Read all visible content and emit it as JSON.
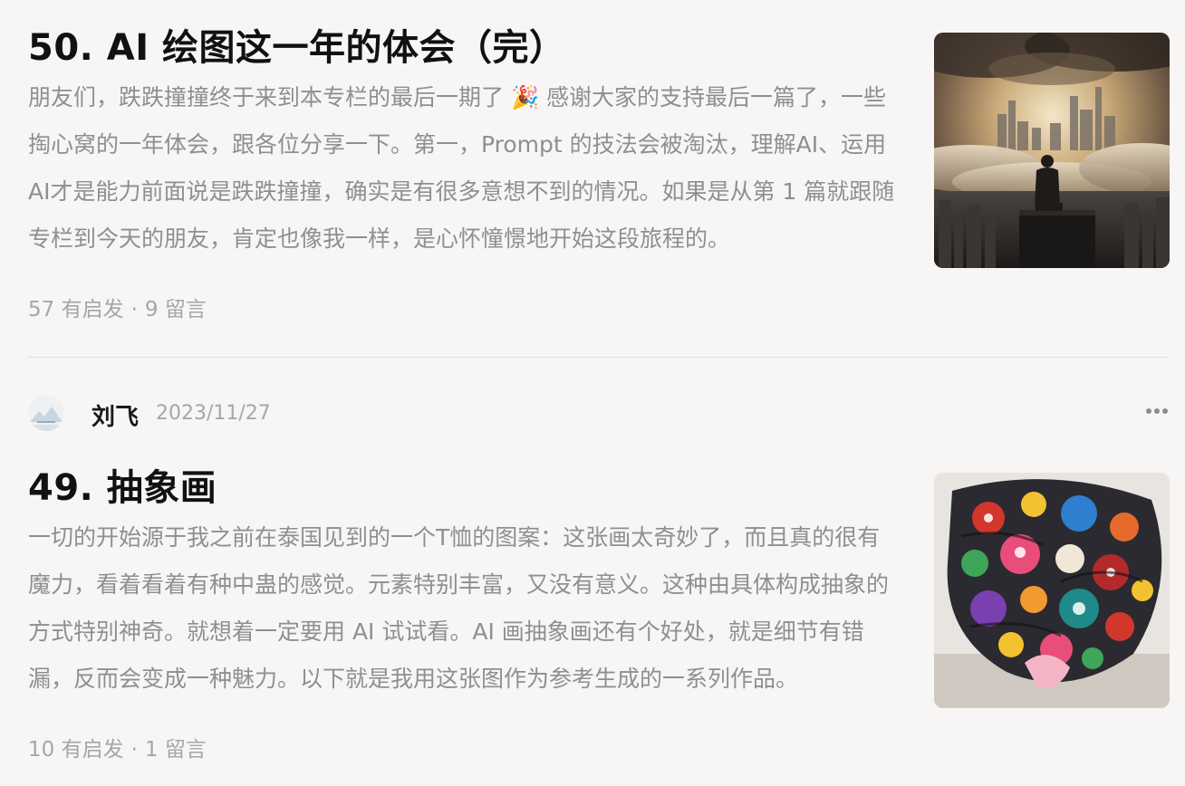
{
  "articles": [
    {
      "title": "50. AI 绘图这一年的体会（完）",
      "excerpt": "朋友们，跌跌撞撞终于来到本专栏的最后一期了 🎉 感谢大家的支持最后一篇了，一些掏心窝的一年体会，跟各位分享一下。第一，Prompt 的技法会被淘汰，理解AI、运用AI才是能力前面说是跌跌撞撞，确实是有很多意想不到的情况。如果是从第 1 篇就跟随专栏到今天的朋友，肯定也像我一样，是心怀憧憬地开始这段旅程的。",
      "stats": {
        "inspired": "57 有启发",
        "separator": "·",
        "comments": "9 留言"
      },
      "thumbnail_icon": "city-clouds-image"
    },
    {
      "author": {
        "name": "刘飞",
        "date": "2023/11/27",
        "avatar_icon": "mountain-avatar-icon"
      },
      "more_icon": "more-dots-icon",
      "title": "49. 抽象画",
      "excerpt": "一切的开始源于我之前在泰国见到的一个T恤的图案：这张画太奇妙了，而且真的很有魔力，看着看着有种中蛊的感觉。元素特别丰富，又没有意义。这种由具体构成抽象的方式特别神奇。就想着一定要用 AI 试试看。AI 画抽象画还有个好处，就是细节有错漏，反而会变成一种魅力。以下就是我用这张图作为参考生成的一系列作品。",
      "stats": {
        "inspired": "10 有启发",
        "separator": "·",
        "comments": "1 留言"
      },
      "thumbnail_icon": "abstract-collage-image"
    }
  ],
  "colors": {
    "background": "#f8f6f5",
    "title": "#111111",
    "excerpt": "#8f8f8f",
    "meta": "#a6a6a6",
    "divider": "#e3e0de"
  }
}
